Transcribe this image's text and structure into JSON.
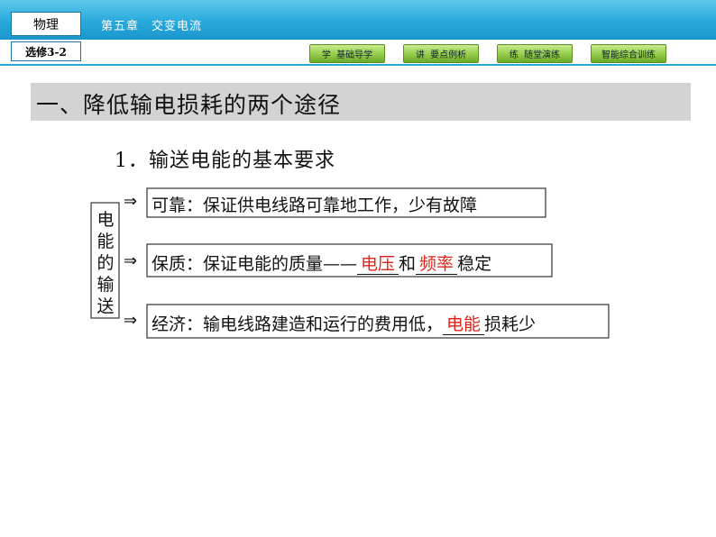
{
  "header": {
    "subject": "物理",
    "chapter": "第五章　交变电流",
    "elective": "选修3-2",
    "nav_buttons": [
      {
        "label": "学  基础导学"
      },
      {
        "label": "讲  要点例析"
      },
      {
        "label": "练  随堂演练"
      },
      {
        "label": "智能综合训练"
      }
    ]
  },
  "section": {
    "title": "一、降低输电损耗的两个途径",
    "subheading": "1．输送电能的基本要求"
  },
  "diagram": {
    "left_label_chars": [
      "电",
      "能",
      "的",
      "输",
      "送"
    ],
    "arrow_symbol": "⇒",
    "rows": [
      {
        "text": "可靠：保证供电线路可靠地工作，少有故障"
      },
      {
        "prefix": "保质：保证电能的质量——",
        "answer1": "电压",
        "middle": "和",
        "answer2": "频率",
        "suffix": "稳定"
      },
      {
        "prefix": "经济：输电线路建造和运行的费用低，",
        "answer1": "电能",
        "suffix": "损耗少"
      }
    ]
  }
}
